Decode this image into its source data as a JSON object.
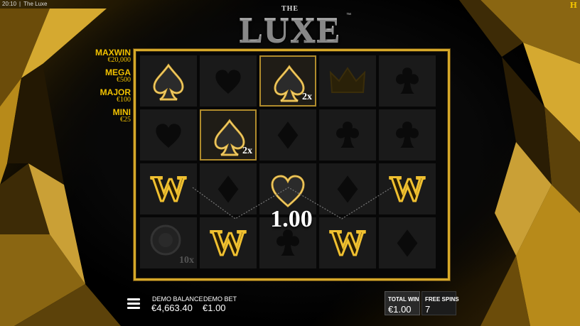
{
  "status_bar": {
    "time": "20:10",
    "separator": "|",
    "app_name": "The Luxe"
  },
  "logo": {
    "the": "THE",
    "main": "LUXE",
    "tm": "™"
  },
  "jackpots": [
    {
      "name": "MAXWIN",
      "value": "€20,000"
    },
    {
      "name": "MEGA",
      "value": "€500"
    },
    {
      "name": "MAJOR",
      "value": "€100"
    },
    {
      "name": "MINI",
      "value": "€25"
    }
  ],
  "grid": {
    "rows": [
      [
        {
          "symbol": "spade",
          "state": "active",
          "mult": ""
        },
        {
          "symbol": "heart",
          "state": "dim",
          "mult": ""
        },
        {
          "symbol": "spade",
          "state": "active-framed",
          "mult": "2x"
        },
        {
          "symbol": "crown",
          "state": "dim",
          "mult": ""
        },
        {
          "symbol": "club",
          "state": "dim",
          "mult": ""
        }
      ],
      [
        {
          "symbol": "heart",
          "state": "dim",
          "mult": ""
        },
        {
          "symbol": "spade",
          "state": "active-framed",
          "mult": "2x"
        },
        {
          "symbol": "diamond",
          "state": "dim",
          "mult": ""
        },
        {
          "symbol": "club",
          "state": "dim",
          "mult": ""
        },
        {
          "symbol": "club",
          "state": "dim",
          "mult": ""
        }
      ],
      [
        {
          "symbol": "W",
          "state": "active",
          "mult": ""
        },
        {
          "symbol": "diamond",
          "state": "dim",
          "mult": ""
        },
        {
          "symbol": "heart",
          "state": "active",
          "mult": ""
        },
        {
          "symbol": "diamond",
          "state": "dim",
          "mult": ""
        },
        {
          "symbol": "W",
          "state": "active",
          "mult": ""
        }
      ],
      [
        {
          "symbol": "chip",
          "state": "dim",
          "mult": "10x"
        },
        {
          "symbol": "W",
          "state": "active",
          "mult": ""
        },
        {
          "symbol": "club",
          "state": "dim",
          "mult": ""
        },
        {
          "symbol": "W",
          "state": "active",
          "mult": ""
        },
        {
          "symbol": "diamond",
          "state": "dim",
          "mult": ""
        }
      ]
    ]
  },
  "win_display": "1.00",
  "bottom_bar": {
    "balance_label": "DEMO BALANCE",
    "balance_value": "€4,663.40",
    "bet_label": "DEMO BET",
    "bet_value": "€1.00",
    "total_win_label": "TOTAL WIN",
    "total_win_value": "€1.00",
    "free_spins_label": "FREE SPINS",
    "free_spins_value": "7"
  },
  "brand_mark": "H",
  "colors": {
    "gold": "#d6a92a",
    "jackpot": "#f2c200"
  }
}
